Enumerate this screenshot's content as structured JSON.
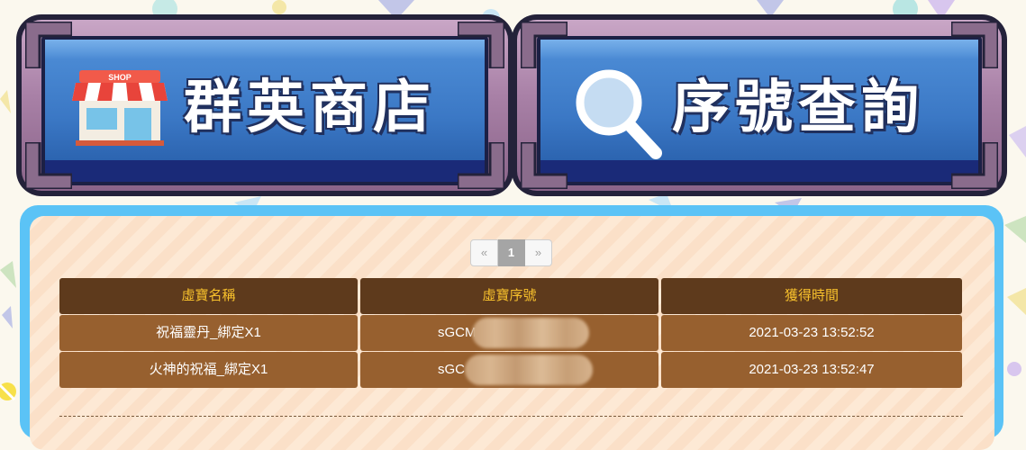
{
  "nav": {
    "shop_label": "群英商店",
    "shop_badge": "SHOP",
    "serial_label": "序號查詢"
  },
  "pagination": {
    "prev": "«",
    "current": "1",
    "next": "»"
  },
  "table": {
    "headers": [
      "虛寶名稱",
      "虛寶序號",
      "獲得時間"
    ],
    "rows": [
      {
        "name": "祝福靈丹_綁定X1",
        "serial": "sGCM",
        "time": "2021-03-23 13:52:52"
      },
      {
        "name": "火神的祝福_綁定X1",
        "serial": "sGC",
        "time": "2021-03-23 13:52:47"
      }
    ]
  },
  "colors": {
    "header_bg": "#5e3a1c",
    "header_text": "#f7c02c",
    "row_bg": "#97602f",
    "card_border": "#5bc3f6",
    "button_blue": "#3b78c5"
  },
  "icons": {
    "shop": "storefront-icon",
    "search": "magnifier-icon"
  }
}
